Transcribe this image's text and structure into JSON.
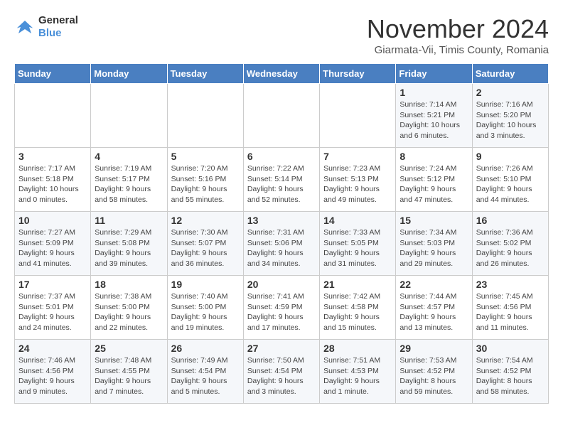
{
  "logo": {
    "line1": "General",
    "line2": "Blue"
  },
  "title": "November 2024",
  "subtitle": "Giarmata-Vii, Timis County, Romania",
  "weekdays": [
    "Sunday",
    "Monday",
    "Tuesday",
    "Wednesday",
    "Thursday",
    "Friday",
    "Saturday"
  ],
  "weeks": [
    [
      {
        "day": "",
        "info": ""
      },
      {
        "day": "",
        "info": ""
      },
      {
        "day": "",
        "info": ""
      },
      {
        "day": "",
        "info": ""
      },
      {
        "day": "",
        "info": ""
      },
      {
        "day": "1",
        "info": "Sunrise: 7:14 AM\nSunset: 5:21 PM\nDaylight: 10 hours and 6 minutes."
      },
      {
        "day": "2",
        "info": "Sunrise: 7:16 AM\nSunset: 5:20 PM\nDaylight: 10 hours and 3 minutes."
      }
    ],
    [
      {
        "day": "3",
        "info": "Sunrise: 7:17 AM\nSunset: 5:18 PM\nDaylight: 10 hours and 0 minutes."
      },
      {
        "day": "4",
        "info": "Sunrise: 7:19 AM\nSunset: 5:17 PM\nDaylight: 9 hours and 58 minutes."
      },
      {
        "day": "5",
        "info": "Sunrise: 7:20 AM\nSunset: 5:16 PM\nDaylight: 9 hours and 55 minutes."
      },
      {
        "day": "6",
        "info": "Sunrise: 7:22 AM\nSunset: 5:14 PM\nDaylight: 9 hours and 52 minutes."
      },
      {
        "day": "7",
        "info": "Sunrise: 7:23 AM\nSunset: 5:13 PM\nDaylight: 9 hours and 49 minutes."
      },
      {
        "day": "8",
        "info": "Sunrise: 7:24 AM\nSunset: 5:12 PM\nDaylight: 9 hours and 47 minutes."
      },
      {
        "day": "9",
        "info": "Sunrise: 7:26 AM\nSunset: 5:10 PM\nDaylight: 9 hours and 44 minutes."
      }
    ],
    [
      {
        "day": "10",
        "info": "Sunrise: 7:27 AM\nSunset: 5:09 PM\nDaylight: 9 hours and 41 minutes."
      },
      {
        "day": "11",
        "info": "Sunrise: 7:29 AM\nSunset: 5:08 PM\nDaylight: 9 hours and 39 minutes."
      },
      {
        "day": "12",
        "info": "Sunrise: 7:30 AM\nSunset: 5:07 PM\nDaylight: 9 hours and 36 minutes."
      },
      {
        "day": "13",
        "info": "Sunrise: 7:31 AM\nSunset: 5:06 PM\nDaylight: 9 hours and 34 minutes."
      },
      {
        "day": "14",
        "info": "Sunrise: 7:33 AM\nSunset: 5:05 PM\nDaylight: 9 hours and 31 minutes."
      },
      {
        "day": "15",
        "info": "Sunrise: 7:34 AM\nSunset: 5:03 PM\nDaylight: 9 hours and 29 minutes."
      },
      {
        "day": "16",
        "info": "Sunrise: 7:36 AM\nSunset: 5:02 PM\nDaylight: 9 hours and 26 minutes."
      }
    ],
    [
      {
        "day": "17",
        "info": "Sunrise: 7:37 AM\nSunset: 5:01 PM\nDaylight: 9 hours and 24 minutes."
      },
      {
        "day": "18",
        "info": "Sunrise: 7:38 AM\nSunset: 5:00 PM\nDaylight: 9 hours and 22 minutes."
      },
      {
        "day": "19",
        "info": "Sunrise: 7:40 AM\nSunset: 5:00 PM\nDaylight: 9 hours and 19 minutes."
      },
      {
        "day": "20",
        "info": "Sunrise: 7:41 AM\nSunset: 4:59 PM\nDaylight: 9 hours and 17 minutes."
      },
      {
        "day": "21",
        "info": "Sunrise: 7:42 AM\nSunset: 4:58 PM\nDaylight: 9 hours and 15 minutes."
      },
      {
        "day": "22",
        "info": "Sunrise: 7:44 AM\nSunset: 4:57 PM\nDaylight: 9 hours and 13 minutes."
      },
      {
        "day": "23",
        "info": "Sunrise: 7:45 AM\nSunset: 4:56 PM\nDaylight: 9 hours and 11 minutes."
      }
    ],
    [
      {
        "day": "24",
        "info": "Sunrise: 7:46 AM\nSunset: 4:56 PM\nDaylight: 9 hours and 9 minutes."
      },
      {
        "day": "25",
        "info": "Sunrise: 7:48 AM\nSunset: 4:55 PM\nDaylight: 9 hours and 7 minutes."
      },
      {
        "day": "26",
        "info": "Sunrise: 7:49 AM\nSunset: 4:54 PM\nDaylight: 9 hours and 5 minutes."
      },
      {
        "day": "27",
        "info": "Sunrise: 7:50 AM\nSunset: 4:54 PM\nDaylight: 9 hours and 3 minutes."
      },
      {
        "day": "28",
        "info": "Sunrise: 7:51 AM\nSunset: 4:53 PM\nDaylight: 9 hours and 1 minute."
      },
      {
        "day": "29",
        "info": "Sunrise: 7:53 AM\nSunset: 4:52 PM\nDaylight: 8 hours and 59 minutes."
      },
      {
        "day": "30",
        "info": "Sunrise: 7:54 AM\nSunset: 4:52 PM\nDaylight: 8 hours and 58 minutes."
      }
    ]
  ],
  "colors": {
    "header_bg": "#4a7fc1",
    "header_text": "#ffffff",
    "odd_row": "#f5f7fa",
    "even_row": "#ffffff"
  }
}
